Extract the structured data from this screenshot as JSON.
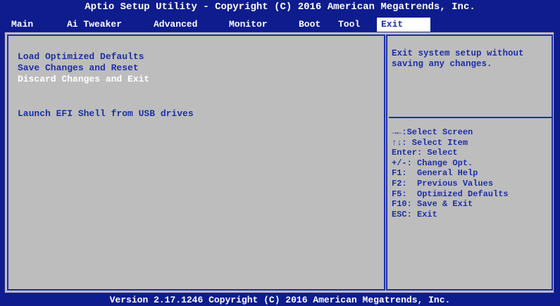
{
  "header": {
    "title": "Aptio Setup Utility - Copyright (C) 2016 American Megatrends, Inc."
  },
  "tabs": [
    {
      "label": "Main"
    },
    {
      "label": "Ai Tweaker"
    },
    {
      "label": "Advanced"
    },
    {
      "label": "Monitor"
    },
    {
      "label": "Boot"
    },
    {
      "label": "Tool"
    },
    {
      "label": "Exit",
      "active": true
    }
  ],
  "menu": {
    "items": [
      {
        "label": "Load Optimized Defaults"
      },
      {
        "label": "Save Changes and Reset"
      },
      {
        "label": "Discard Changes and Exit",
        "selected": true
      },
      {
        "label": "Launch EFI Shell from USB drives"
      }
    ]
  },
  "help": {
    "text": "Exit system setup without saving any changes."
  },
  "keys": [
    "→←:Select Screen",
    "↑↓: Select Item",
    "Enter: Select",
    "+/-: Change Opt.",
    "F1:  General Help",
    "F2:  Previous Values",
    "F5:  Optimized Defaults",
    "F10: Save & Exit",
    "ESC: Exit"
  ],
  "footer": {
    "text": "Version 2.17.1246 Copyright (C) 2016 American Megatrends, Inc."
  },
  "colors": {
    "background": "#0e1c8e",
    "panel": "#bdbdbd",
    "text": "#1d2fa6",
    "highlight": "#ffffff"
  }
}
